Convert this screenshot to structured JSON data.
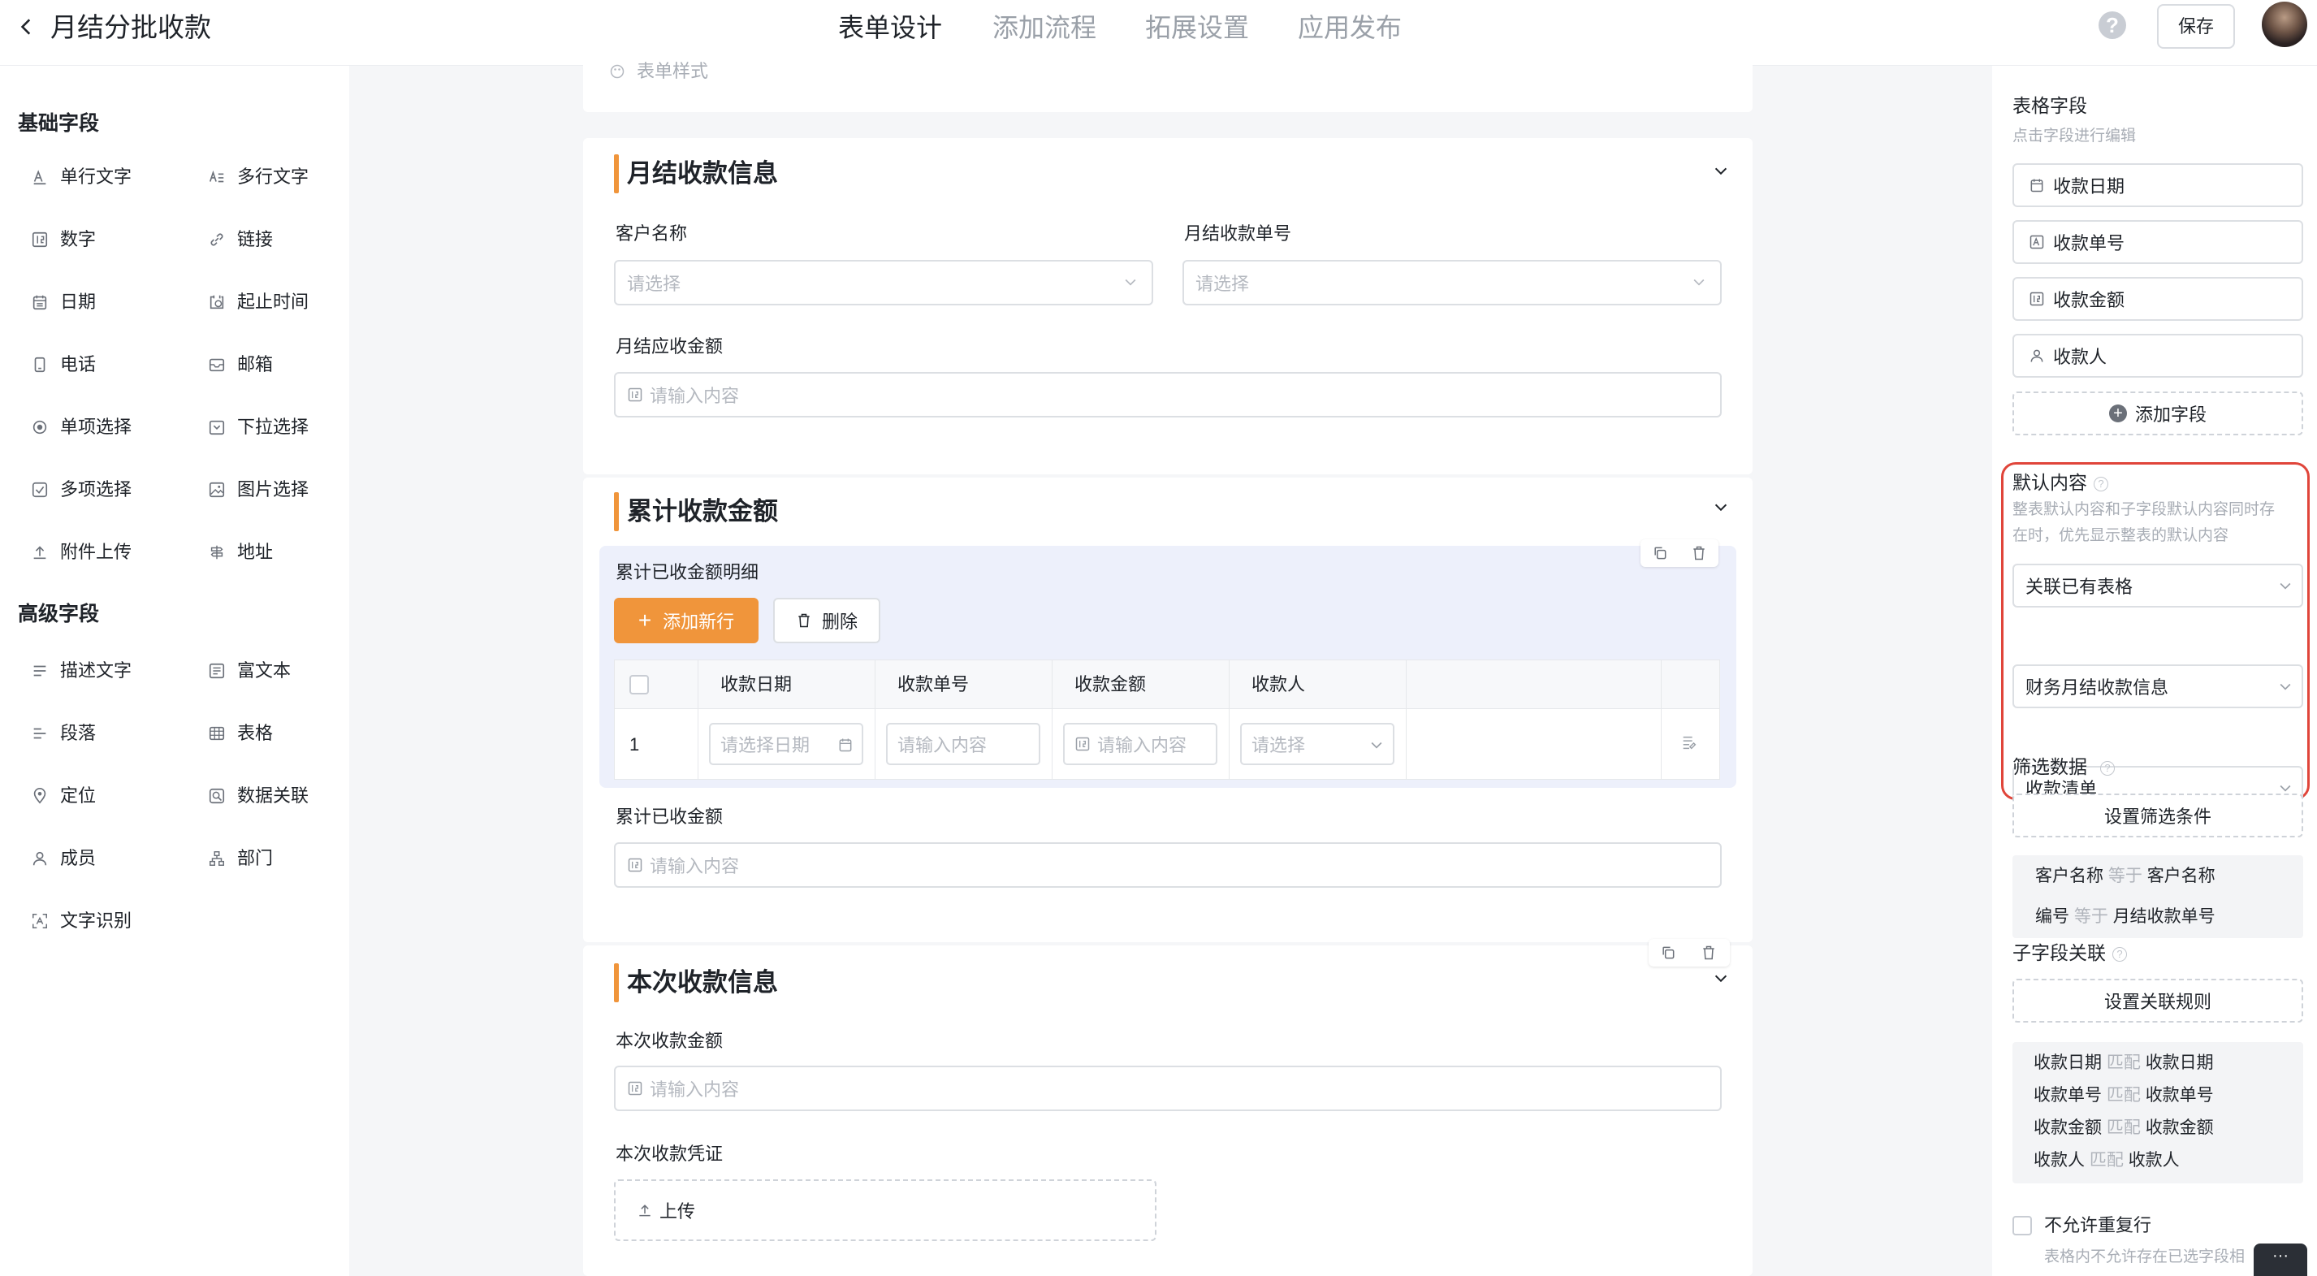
{
  "header": {
    "title": "月结分批收款",
    "tabs": [
      "表单设计",
      "添加流程",
      "拓展设置",
      "应用发布"
    ],
    "help": "?",
    "save_label": "保存"
  },
  "left_panel": {
    "basic_title": "基础字段",
    "basic_fields": [
      "单行文字",
      "多行文字",
      "数字",
      "链接",
      "日期",
      "起止时间",
      "电话",
      "邮箱",
      "单项选择",
      "下拉选择",
      "多项选择",
      "图片选择",
      "附件上传",
      "地址"
    ],
    "advanced_title": "高级字段",
    "advanced_fields": [
      "描述文字",
      "富文本",
      "段落",
      "表格",
      "定位",
      "数据关联",
      "成员",
      "部门",
      "文字识别"
    ]
  },
  "form": {
    "style_label": "表单样式",
    "section1": {
      "title": "月结收款信息",
      "customer_label": "客户名称",
      "customer_placeholder": "请选择",
      "order_label": "月结收款单号",
      "order_placeholder": "请选择",
      "amount_label": "月结应收金额",
      "amount_placeholder": "请输入内容"
    },
    "section2": {
      "title": "累计收款金额",
      "subtable_title": "累计已收金额明细",
      "add_row": "添加新行",
      "delete": "删除",
      "columns": [
        "收款日期",
        "收款单号",
        "收款金额",
        "收款人"
      ],
      "row_index": "1",
      "row_placeholders": [
        "请选择日期",
        "请输入内容",
        "请输入内容",
        "请选择"
      ],
      "total_label": "累计已收金额",
      "total_placeholder": "请输入内容"
    },
    "section3": {
      "title": "本次收款信息",
      "amount_label": "本次收款金额",
      "amount_placeholder": "请输入内容",
      "voucher_label": "本次收款凭证",
      "upload": "上传"
    }
  },
  "right_panel": {
    "table_fields_title": "表格字段",
    "table_fields_hint": "点击字段进行编辑",
    "fields": [
      "收款日期",
      "收款单号",
      "收款金额",
      "收款人"
    ],
    "add_field": "添加字段",
    "default_title": "默认内容",
    "default_hint_1": "整表默认内容和子字段默认内容同时存",
    "default_hint_2": "在时，优先显示整表的默认内容",
    "selects": [
      "关联已有表格",
      "财务月结收款信息",
      "收款清单"
    ],
    "filter_title": "筛选数据",
    "filter_btn": "设置筛选条件",
    "filter_rules": [
      {
        "left": "客户名称",
        "op": "等于",
        "right": "客户名称"
      },
      {
        "left": "编号",
        "op": "等于",
        "right": "月结收款单号"
      }
    ],
    "sub_title": "子字段关联",
    "sub_btn": "设置关联规则",
    "sub_rules": [
      {
        "left": "收款日期",
        "op": "匹配",
        "right": "收款日期"
      },
      {
        "left": "收款单号",
        "op": "匹配",
        "right": "收款单号"
      },
      {
        "left": "收款金额",
        "op": "匹配",
        "right": "收款金额"
      },
      {
        "left": "收款人",
        "op": "匹配",
        "right": "收款人"
      }
    ],
    "no_dup_label": "不允许重复行",
    "no_dup_hint": "表格内不允许存在已选字段相"
  },
  "colors": {
    "accent": "#f0953b",
    "highlight_border": "#e0453a"
  }
}
